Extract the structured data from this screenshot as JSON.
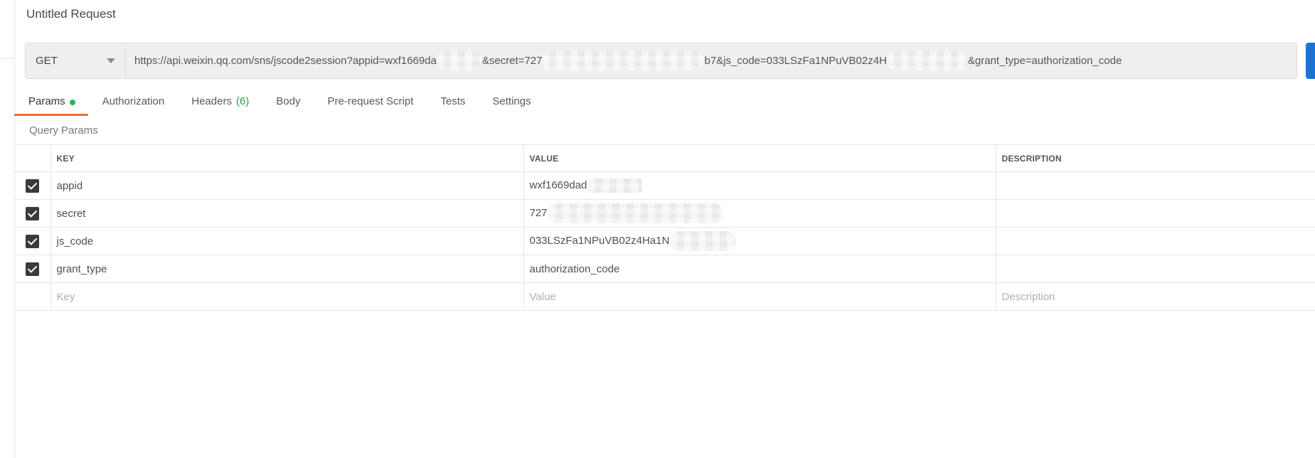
{
  "request": {
    "title": "Untitled Request"
  },
  "url_bar": {
    "method": "GET",
    "url_parts": [
      "https://api.weixin.qq.com/sns/jscode2session?appid=wxf1669da",
      "&secret=727",
      "b7&js_code=033LSzFa1NPuVB02z4H",
      "&grant_type=authorization_code"
    ]
  },
  "tabs": [
    {
      "label": "Params",
      "active": true
    },
    {
      "label": "Authorization"
    },
    {
      "label": "Headers",
      "count": "(6)"
    },
    {
      "label": "Body"
    },
    {
      "label": "Pre-request Script"
    },
    {
      "label": "Tests"
    },
    {
      "label": "Settings"
    }
  ],
  "query_params": {
    "title": "Query Params",
    "columns": {
      "key": "KEY",
      "value": "VALUE",
      "description": "DESCRIPTION"
    },
    "rows": [
      {
        "key": "appid",
        "value": "wxf1669dad",
        "checked": true
      },
      {
        "key": "secret",
        "value": "727",
        "checked": true
      },
      {
        "key": "js_code",
        "value": "033LSzFa1NPuVB02z4Ha1N",
        "checked": true
      },
      {
        "key": "grant_type",
        "value": "authorization_code",
        "checked": true
      }
    ],
    "placeholder": {
      "key": "Key",
      "value": "Value",
      "description": "Description"
    }
  },
  "colors": {
    "active_tab_underline": "#f26b3a",
    "params_dot": "#26b55a",
    "headers_count": "#2b9a4c",
    "send_button": "#1a73d8"
  }
}
